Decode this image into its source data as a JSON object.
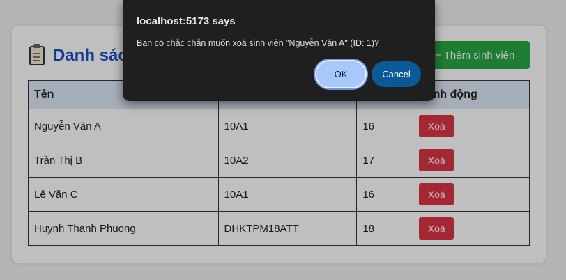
{
  "page": {
    "title": "Danh sách sinh viên",
    "add_button": "+ Thêm sinh viên"
  },
  "table": {
    "headers": [
      "Tên",
      "",
      "",
      "Hành động"
    ],
    "rows": [
      {
        "name": "Nguyễn Văn A",
        "class": "10A1",
        "age": "16",
        "action": "Xoá"
      },
      {
        "name": "Trần Thị B",
        "class": "10A2",
        "age": "17",
        "action": "Xoá"
      },
      {
        "name": "Lê Văn C",
        "class": "10A1",
        "age": "16",
        "action": "Xoá"
      },
      {
        "name": "Huynh Thanh Phuong",
        "class": "DHKTPM18ATT",
        "age": "18",
        "action": "Xoá"
      }
    ]
  },
  "dialog": {
    "title": "localhost:5173 says",
    "message": "Bạn có chắc chắn muốn xoá sinh viên \"Nguyễn Văn A\" (ID: 1)?",
    "ok_label": "OK",
    "cancel_label": "Cancel"
  },
  "icons": {
    "title_icon": "clipboard-icon"
  },
  "colors": {
    "title": "#1a4fc4",
    "add_button": "#28a745",
    "delete_button": "#dc3545",
    "header_bg": "#dde7f6",
    "dialog_bg": "#1f1f1f",
    "ok_button": "#a8c7fa",
    "cancel_button": "#0a5a99"
  }
}
